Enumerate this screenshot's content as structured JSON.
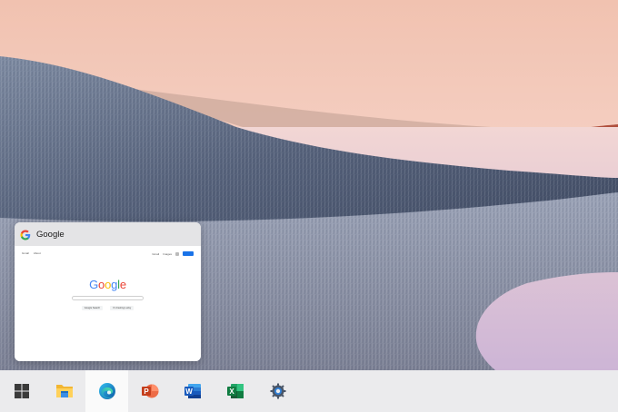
{
  "preview": {
    "title": "Google",
    "page": {
      "top_links": [
        "Gmail",
        "About"
      ],
      "right_links": [
        "Gmail",
        "Images"
      ],
      "logo_letters": [
        {
          "char": "G",
          "color": "#4285F4"
        },
        {
          "char": "o",
          "color": "#EA4335"
        },
        {
          "char": "o",
          "color": "#FBBC05"
        },
        {
          "char": "g",
          "color": "#4285F4"
        },
        {
          "char": "l",
          "color": "#34A853"
        },
        {
          "char": "e",
          "color": "#EA4335"
        }
      ],
      "buttons": [
        "Google Search",
        "I'm Feeling Lucky"
      ]
    }
  },
  "taskbar": {
    "items": [
      {
        "name": "start",
        "icon": "windows-logo-icon",
        "active": false
      },
      {
        "name": "file-explorer",
        "icon": "folder-icon",
        "active": false
      },
      {
        "name": "edge",
        "icon": "edge-icon",
        "active": true
      },
      {
        "name": "powerpoint",
        "icon": "powerpoint-icon",
        "active": false
      },
      {
        "name": "word",
        "icon": "word-icon",
        "active": false
      },
      {
        "name": "excel",
        "icon": "excel-icon",
        "active": false
      },
      {
        "name": "settings",
        "icon": "gear-icon",
        "active": false
      }
    ]
  },
  "colors": {
    "taskbar_bg": "#ebebed",
    "active_item_bg": "#fafafa",
    "sky_top": "#f3c9b7",
    "sky_horizon": "#f6d8d0",
    "grass": "#6f7b93",
    "water": "#d9c1d8"
  }
}
